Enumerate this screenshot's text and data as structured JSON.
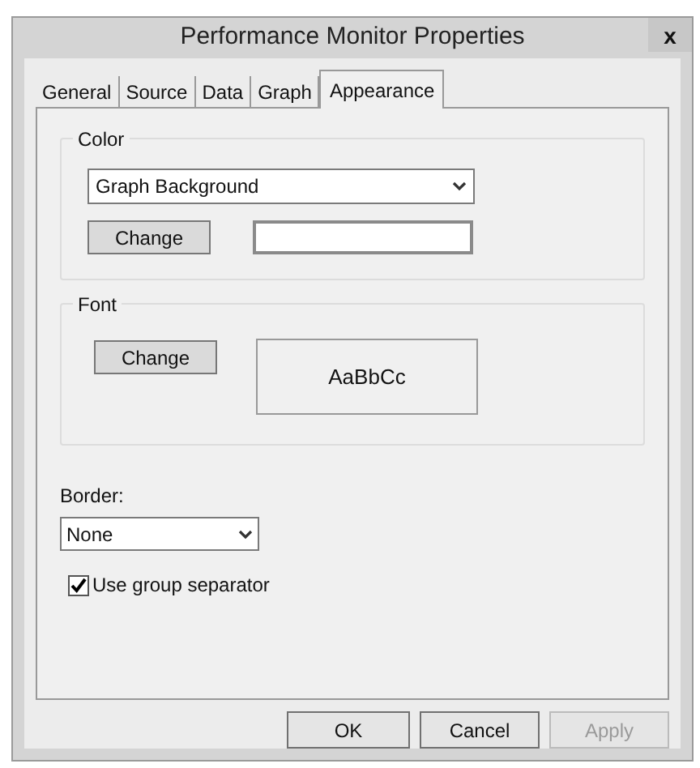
{
  "window": {
    "title": "Performance Monitor Properties",
    "close": "x"
  },
  "tabs": [
    {
      "label": "General",
      "selected": false
    },
    {
      "label": "Source",
      "selected": false
    },
    {
      "label": "Data",
      "selected": false
    },
    {
      "label": "Graph",
      "selected": false
    },
    {
      "label": "Appearance",
      "selected": true
    }
  ],
  "color_group": {
    "title": "Color",
    "dropdown": "Graph Background",
    "button": "Change"
  },
  "font_group": {
    "title": "Font",
    "button": "Change",
    "sample": "AaBbCc"
  },
  "border": {
    "label": "Border:",
    "value": "None"
  },
  "group_separator": {
    "label": "Use group separator",
    "checked": true
  },
  "buttons": [
    {
      "label": "OK",
      "disabled": false
    },
    {
      "label": "Cancel",
      "disabled": false
    },
    {
      "label": "Apply",
      "disabled": true
    }
  ]
}
